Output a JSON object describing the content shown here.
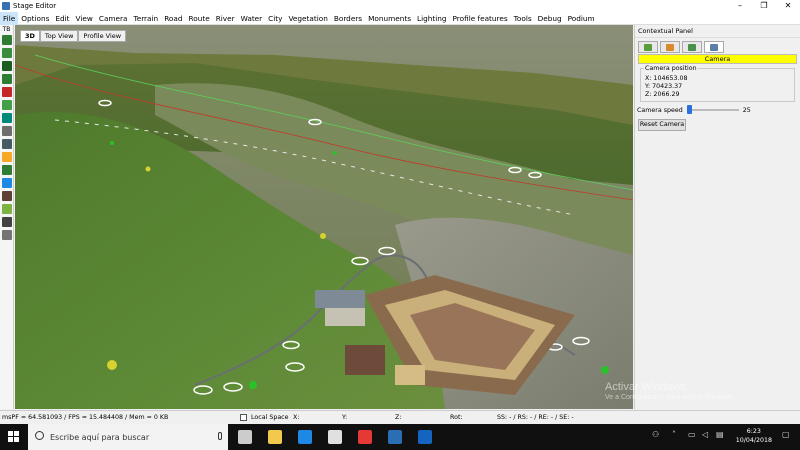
{
  "window": {
    "title": "Stage Editor",
    "controls": [
      "–",
      "❐",
      "✕"
    ]
  },
  "menu": [
    "File",
    "Options",
    "Edit",
    "View",
    "Camera",
    "Terrain",
    "Road",
    "Route",
    "River",
    "Water",
    "City",
    "Vegetation",
    "Borders",
    "Monuments",
    "Lighting",
    "Profile features",
    "Tools",
    "Debug",
    "Podium"
  ],
  "toolbar": {
    "label": "TB",
    "tools": [
      {
        "icon": "terrain-icon",
        "color": "#2e7d32"
      },
      {
        "icon": "terrain-smooth-icon",
        "color": "#388e3c"
      },
      {
        "icon": "terrain-hills-icon",
        "color": "#1b5e20"
      },
      {
        "icon": "road-icon",
        "color": "#2e7d32"
      },
      {
        "icon": "route-icon",
        "color": "#c62828"
      },
      {
        "icon": "river-icon",
        "color": "#43a047"
      },
      {
        "icon": "water-icon",
        "color": "#00897b"
      },
      {
        "icon": "city-icon",
        "color": "#6d6d6d"
      },
      {
        "icon": "building-icon",
        "color": "#455a64"
      },
      {
        "icon": "vegetation-icon",
        "color": "#f9a825"
      },
      {
        "icon": "tree-icon",
        "color": "#2e7d32"
      },
      {
        "icon": "border-icon",
        "color": "#1e88e5"
      },
      {
        "icon": "monument-icon",
        "color": "#5d4037"
      },
      {
        "icon": "lighting-icon",
        "color": "#7cb342"
      },
      {
        "icon": "profile-icon",
        "color": "#424242"
      },
      {
        "icon": "debug-icon",
        "color": "#757575"
      }
    ]
  },
  "view_tabs": [
    "3D",
    "Top View",
    "Profile View"
  ],
  "panel": {
    "title": "Contextual Panel",
    "tabs": [
      {
        "icon": "terrain-tab-icon",
        "color": "#5b9b3a"
      },
      {
        "icon": "vegetation-tab-icon",
        "color": "#d98a2b"
      },
      {
        "icon": "objects-tab-icon",
        "color": "#4a8f4a"
      },
      {
        "icon": "camera-tab-icon",
        "color": "#5d7fa6"
      }
    ],
    "section": "Camera",
    "camera_position_label": "Camera position",
    "x": "X: 104653.08",
    "y": "Y: 70423.37",
    "z": "Z: 2066.29",
    "speed_label": "Camera speed",
    "speed_value": "25",
    "speed_fraction": 0.0,
    "reset_label": "Reset Camera"
  },
  "status": {
    "perf": "msPF = 64.581093 / FPS = 15.484408 / Mem = 0 KB",
    "local_space": "Local Space",
    "x": "X:",
    "y": "Y:",
    "z": "Z:",
    "rot": "Rot:",
    "ss": "SS: - / RS: - / RE: - / SE: -"
  },
  "watermark": {
    "line1": "Activar Windows",
    "line2": "Ve a Configuración para activar Windows."
  },
  "taskbar": {
    "search_placeholder": "Escribe aquí para buscar",
    "apps": [
      {
        "icon": "task-view-icon",
        "color": "#cccccc"
      },
      {
        "icon": "file-explorer-icon",
        "color": "#f2c94c"
      },
      {
        "icon": "edge-icon",
        "color": "#1e88e5"
      },
      {
        "icon": "store-icon",
        "color": "#e0e0e0"
      },
      {
        "icon": "chrome-icon",
        "color": "#e53935"
      },
      {
        "icon": "stage-editor-icon",
        "color": "#2a6fb5"
      },
      {
        "icon": "photos-icon",
        "color": "#1565c0"
      }
    ],
    "time": "6:23",
    "date": "10/04/2018"
  }
}
